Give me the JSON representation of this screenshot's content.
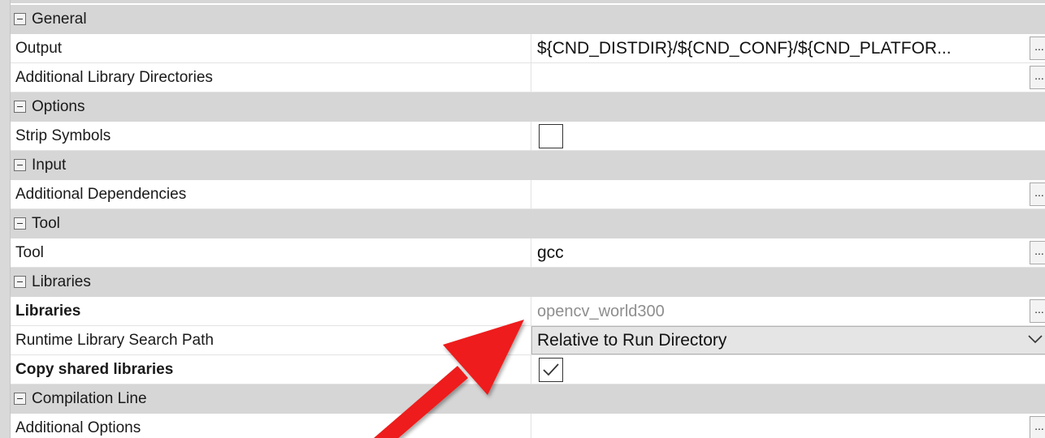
{
  "sections": {
    "general": {
      "label": "General",
      "output": {
        "name": "Output",
        "value": "${CND_DISTDIR}/${CND_CONF}/${CND_PLATFOR..."
      },
      "additional_library_directories": {
        "name": "Additional Library Directories",
        "value": ""
      }
    },
    "options": {
      "label": "Options",
      "strip_symbols": {
        "name": "Strip Symbols",
        "checked": false
      }
    },
    "input": {
      "label": "Input",
      "additional_dependencies": {
        "name": "Additional Dependencies",
        "value": ""
      }
    },
    "tool": {
      "label": "Tool",
      "tool": {
        "name": "Tool",
        "value": "gcc"
      }
    },
    "libraries": {
      "label": "Libraries",
      "libraries": {
        "name": "Libraries",
        "value": "opencv_world300"
      },
      "runtime_search_path": {
        "name": "Runtime Library Search Path",
        "selected": "Relative to Run Directory"
      },
      "copy_shared_libraries": {
        "name": "Copy shared libraries",
        "checked": true
      }
    },
    "compilation_line": {
      "label": "Compilation Line",
      "additional_options": {
        "name": "Additional Options",
        "value": ""
      }
    }
  },
  "buttons": {
    "ellipsis": "..."
  },
  "colors": {
    "category_bg": "#d6d6d6",
    "dropdown_bg": "#e5e5e5",
    "annotation_arrow": "#ee1c1c",
    "muted_text": "#8e8e8e"
  }
}
